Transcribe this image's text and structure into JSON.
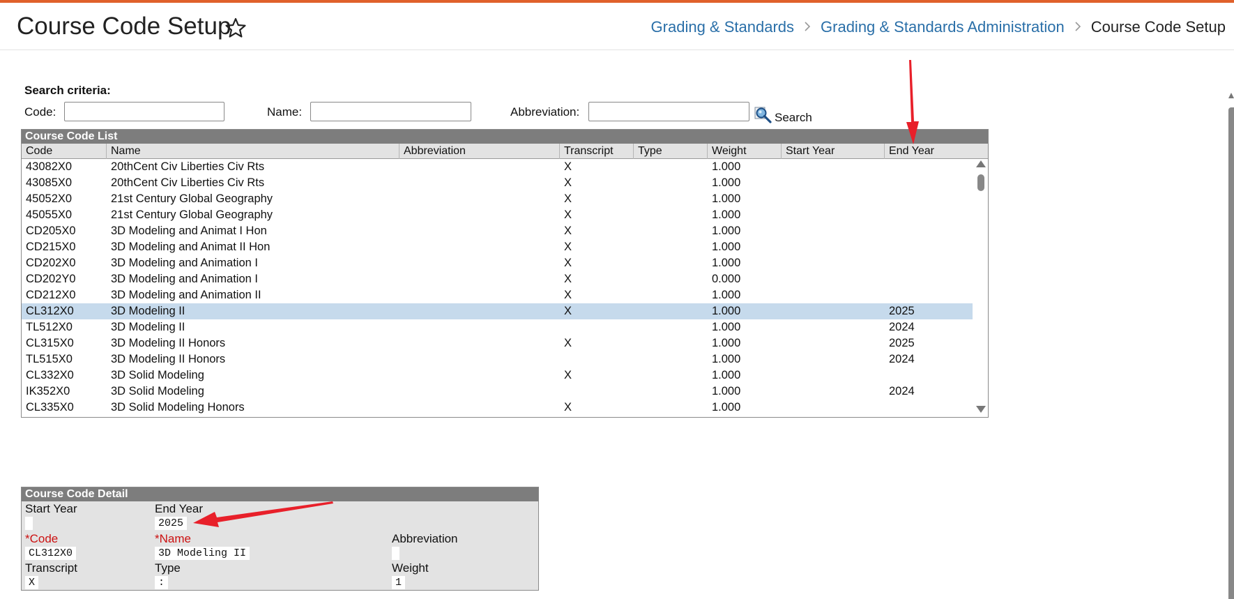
{
  "header": {
    "title": "Course Code Setup",
    "breadcrumb": [
      "Grading & Standards",
      "Grading & Standards Administration",
      "Course Code Setup"
    ],
    "separator": ">"
  },
  "search": {
    "heading": "Search criteria:",
    "code_label": "Code:",
    "name_label": "Name:",
    "abbreviation_label": "Abbreviation:",
    "code_value": "",
    "name_value": "",
    "abbreviation_value": "",
    "button_label": "Search"
  },
  "list": {
    "title": "Course Code List",
    "columns": [
      "Code",
      "Name",
      "Abbreviation",
      "Transcript",
      "Type",
      "Weight",
      "Start Year",
      "End Year"
    ],
    "rows": [
      {
        "code": "43082X0",
        "name": "20thCent Civ Liberties Civ Rts",
        "abbr": "",
        "transcript": "X",
        "type": "",
        "weight": "1.000",
        "start": "",
        "end": ""
      },
      {
        "code": "43085X0",
        "name": "20thCent Civ Liberties Civ Rts",
        "abbr": "",
        "transcript": "X",
        "type": "",
        "weight": "1.000",
        "start": "",
        "end": ""
      },
      {
        "code": "45052X0",
        "name": "21st Century Global Geography",
        "abbr": "",
        "transcript": "X",
        "type": "",
        "weight": "1.000",
        "start": "",
        "end": ""
      },
      {
        "code": "45055X0",
        "name": "21st Century Global Geography",
        "abbr": "",
        "transcript": "X",
        "type": "",
        "weight": "1.000",
        "start": "",
        "end": ""
      },
      {
        "code": "CD205X0",
        "name": "3D Modeling and Animat I Hon",
        "abbr": "",
        "transcript": "X",
        "type": "",
        "weight": "1.000",
        "start": "",
        "end": ""
      },
      {
        "code": "CD215X0",
        "name": "3D Modeling and Animat II Hon",
        "abbr": "",
        "transcript": "X",
        "type": "",
        "weight": "1.000",
        "start": "",
        "end": ""
      },
      {
        "code": "CD202X0",
        "name": "3D Modeling and Animation I",
        "abbr": "",
        "transcript": "X",
        "type": "",
        "weight": "1.000",
        "start": "",
        "end": ""
      },
      {
        "code": "CD202Y0",
        "name": "3D Modeling and Animation I",
        "abbr": "",
        "transcript": "X",
        "type": "",
        "weight": "0.000",
        "start": "",
        "end": ""
      },
      {
        "code": "CD212X0",
        "name": "3D Modeling and Animation II",
        "abbr": "",
        "transcript": "X",
        "type": "",
        "weight": "1.000",
        "start": "",
        "end": ""
      },
      {
        "code": "CL312X0",
        "name": "3D Modeling II",
        "abbr": "",
        "transcript": "X",
        "type": "",
        "weight": "1.000",
        "start": "",
        "end": "2025",
        "selected": true
      },
      {
        "code": "TL512X0",
        "name": "3D Modeling II",
        "abbr": "",
        "transcript": "",
        "type": "",
        "weight": "1.000",
        "start": "",
        "end": "2024"
      },
      {
        "code": "CL315X0",
        "name": "3D Modeling II Honors",
        "abbr": "",
        "transcript": "X",
        "type": "",
        "weight": "1.000",
        "start": "",
        "end": "2025"
      },
      {
        "code": "TL515X0",
        "name": "3D Modeling II Honors",
        "abbr": "",
        "transcript": "",
        "type": "",
        "weight": "1.000",
        "start": "",
        "end": "2024"
      },
      {
        "code": "CL332X0",
        "name": "3D Solid Modeling",
        "abbr": "",
        "transcript": "X",
        "type": "",
        "weight": "1.000",
        "start": "",
        "end": ""
      },
      {
        "code": "IK352X0",
        "name": "3D Solid Modeling",
        "abbr": "",
        "transcript": "",
        "type": "",
        "weight": "1.000",
        "start": "",
        "end": "2024"
      },
      {
        "code": "CL335X0",
        "name": "3D Solid Modeling Honors",
        "abbr": "",
        "transcript": "X",
        "type": "",
        "weight": "1.000",
        "start": "",
        "end": ""
      }
    ]
  },
  "detail": {
    "title": "Course Code Detail",
    "start_year_label": "Start Year",
    "start_year_value": "",
    "end_year_label": "End Year",
    "end_year_value": "2025",
    "code_label": "*Code",
    "code_value": "CL312X0",
    "name_label": "*Name",
    "name_value": "3D Modeling II",
    "abbreviation_label": "Abbreviation",
    "abbreviation_value": "",
    "transcript_label": "Transcript",
    "transcript_value": "X",
    "type_label": "Type",
    "type_value": ":",
    "weight_label": "Weight",
    "weight_value": "1"
  },
  "colors": {
    "accent_bar": "#e0612b",
    "link": "#2a6fa8",
    "panel_header": "#7d7d7d",
    "selected_row": "#c6daec",
    "required_label": "#cc1111",
    "annotation_arrow": "#e8202a"
  },
  "icons": {
    "favorite": "star-icon",
    "search": "search-magnifier-icon",
    "scroll_up": "triangle-up-icon",
    "scroll_down": "triangle-down-icon"
  }
}
